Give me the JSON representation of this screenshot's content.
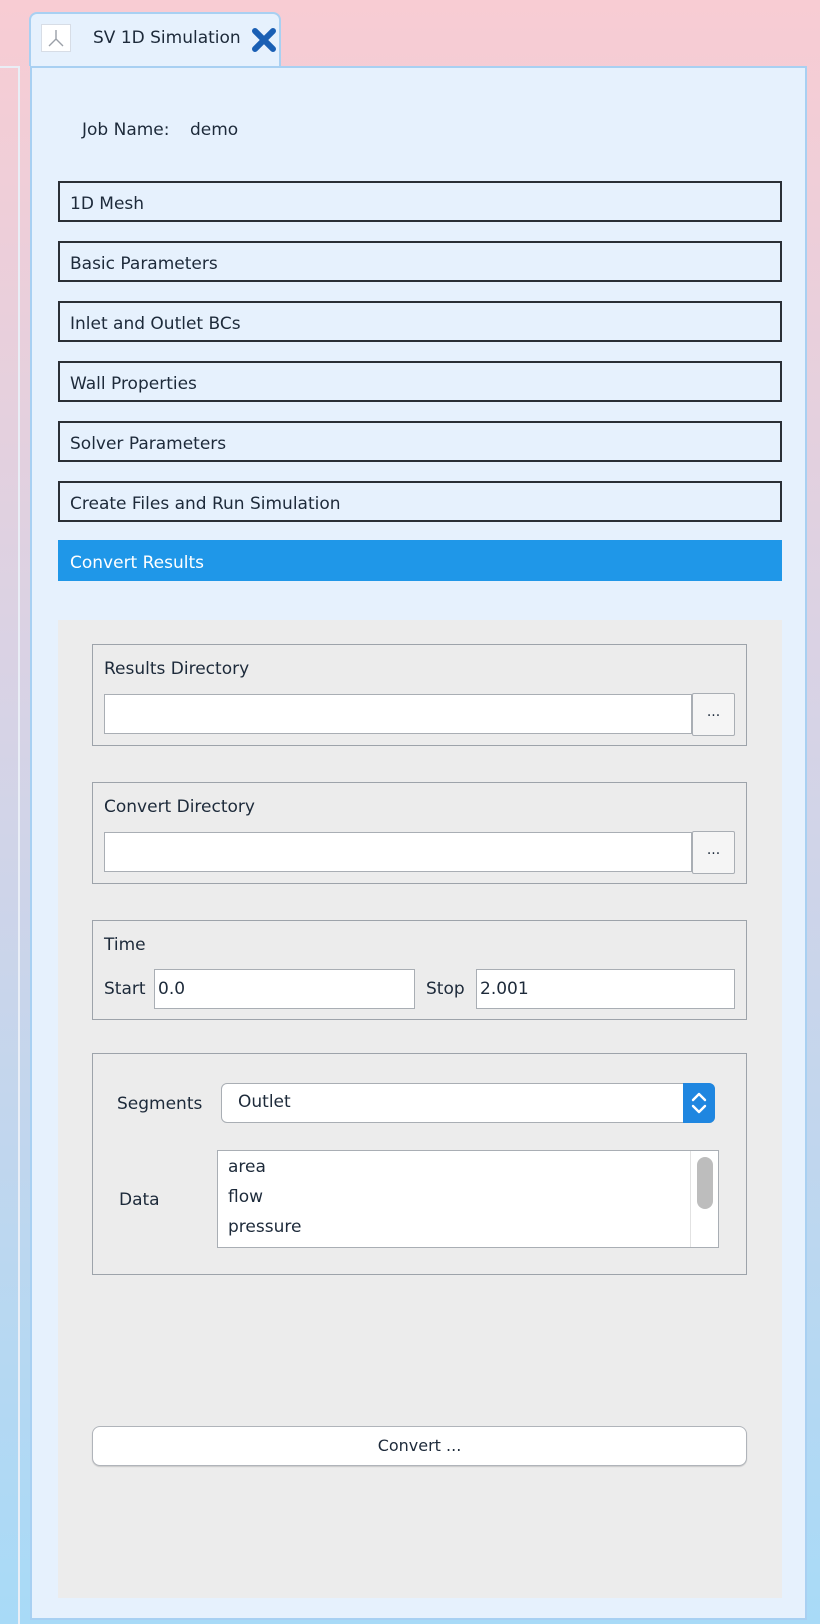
{
  "tab": {
    "title": "SV 1D Simulation",
    "logo_icon": "app-logo-icon",
    "close_icon": "close-icon",
    "close_color": "#1a5fb4"
  },
  "job": {
    "label": "Job Name:",
    "value": "demo"
  },
  "sections": [
    {
      "label": "1D Mesh"
    },
    {
      "label": "Basic Parameters"
    },
    {
      "label": "Inlet and Outlet BCs"
    },
    {
      "label": "Wall Properties"
    },
    {
      "label": "Solver Parameters"
    },
    {
      "label": "Create Files and Run Simulation"
    },
    {
      "label": "Convert Results",
      "active": true
    }
  ],
  "accent_color": "#1f97e8",
  "results_dir": {
    "title": "Results Directory",
    "value": "",
    "browse_label": "..."
  },
  "convert_dir": {
    "title": "Convert Directory",
    "value": "",
    "browse_label": "..."
  },
  "time": {
    "title": "Time",
    "start_label": "Start",
    "start_value": "0.0",
    "stop_label": "Stop",
    "stop_value": "2.001"
  },
  "segments": {
    "label": "Segments",
    "selected": "Outlet"
  },
  "data_list": {
    "label": "Data",
    "items": [
      "area",
      "flow",
      "pressure"
    ]
  },
  "convert_button": {
    "label": "Convert ..."
  }
}
